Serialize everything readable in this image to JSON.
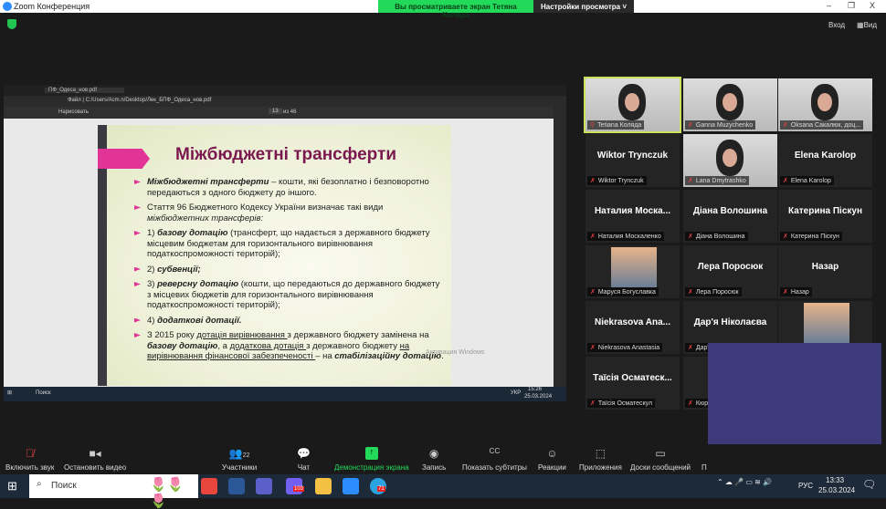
{
  "window": {
    "title": "Zoom Конференция",
    "minimize": "–",
    "restore": "❐",
    "close": "X"
  },
  "banner": {
    "viewing": "Вы просматриваете экран Тетяна Колядa",
    "view_options": "Настройки просмотра ˅"
  },
  "topbar": {
    "exit": "Вход",
    "view": "Вид"
  },
  "browser": {
    "tab": "ПФ_Одеса_нов.pdf",
    "address": "Файл | C:/Users/Acm.n/Desktop/Лек_БПФ_Одеса_нов.pdf",
    "draw": "Нарисовать",
    "page": "13",
    "page_total": "из 46"
  },
  "slide": {
    "title": "Міжбюджетні трансферти",
    "b1_bold": "Міжбюджетні трансферти",
    "b1": " – кошти, які безоплатно і безповоротно передаються з одного бюджету до іншого.",
    "b2": "Стаття 96 Бюджетного Кодексу України визначає такі види ",
    "b2_it": "міжбюджетних трансферів:",
    "b3_n": "1) ",
    "b3_bold": "базову дотацію",
    "b3": " (трансферт, що надається з державного бюджету місцевим бюджетам для горизонтального вирівнювання податкоспроможності територій);",
    "b4_n": "2) ",
    "b4_bold": "субвенції;",
    "b5_n": "3) ",
    "b5_bold": "реверсну дотацію",
    "b5": " (кошти, що передаються до державного бюджету з місцевих бюджетів для горизонтального вирівнювання податкоспроможності територій);",
    "b6_n": "4) ",
    "b6_bold": "додаткові дотації.",
    "b7a": "З 2015 року ",
    "b7u1": "дотація вирівнювання ",
    "b7b": "з державного бюджету замінена на ",
    "b7bold1": "базову дотацію",
    "b7c": ", а ",
    "b7u2": "додаткова дотація ",
    "b7d": "з державного бюджету ",
    "b7u3": "на вирівнювання фінансової забезпеченості ",
    "b7e": "– на ",
    "b7bold2": "стабілізаційну дотацію",
    "b7f": "."
  },
  "watermark": "Активация Windows",
  "inner_taskbar": {
    "search": "Поиск",
    "lang": "УКР",
    "time": "15:26",
    "date": "25.03.2024"
  },
  "participants": [
    {
      "big": "",
      "label": "Tetiana Коляда",
      "video": true,
      "active": true
    },
    {
      "big": "",
      "label": "Ganna Muzychenko",
      "video": true
    },
    {
      "big": "",
      "label": "Oksana Сакалюк, доц...",
      "video": true
    },
    {
      "big": "Wiktor Trynczuk",
      "label": "Wiktor Trynczuk"
    },
    {
      "big": "",
      "label": "Lana Dmytrashko",
      "video": true
    },
    {
      "big": "Elena Karolop",
      "label": "Elena Karolop"
    },
    {
      "big": "Наталия Моска...",
      "label": "Наталия Москаленко"
    },
    {
      "big": "Діана Волошина",
      "label": "Діана Волошина"
    },
    {
      "big": "Катерина Піскун",
      "label": "Катерина Піскун"
    },
    {
      "big": "",
      "label": "Маруся Богуславка",
      "avatar": true
    },
    {
      "big": "Лера Поросюк",
      "label": "Лера Поросюк"
    },
    {
      "big": "Назар",
      "label": "Назар"
    },
    {
      "big": "Niekrasova Ana...",
      "label": "Niekrasova Anastasia"
    },
    {
      "big": "Дар'я Ніколаєва",
      "label": "Дар'я Ніколаєва"
    },
    {
      "big": "",
      "label": "",
      "avatar": true
    },
    {
      "big": "Таїсія Осматеск...",
      "label": "Таїсія Осматескул"
    },
    {
      "big": "Кюр",
      "label": "Кюр"
    }
  ],
  "toolbar": {
    "audio": "Включить звук",
    "video": "Остановить видео",
    "participants": "Участники",
    "participants_count": "22",
    "chat": "Чат",
    "share": "Демонстрация экрана",
    "record": "Запись",
    "captions": "Показать субтитры",
    "reactions": "Реакции",
    "apps": "Приложения",
    "whiteboards": "Доски сообщений",
    "more": "П"
  },
  "taskbar": {
    "search": "Поиск",
    "lang": "РУС",
    "time": "13:33",
    "date": "25.03.2024",
    "viber_badge": "103",
    "telegram_badge": "71"
  }
}
